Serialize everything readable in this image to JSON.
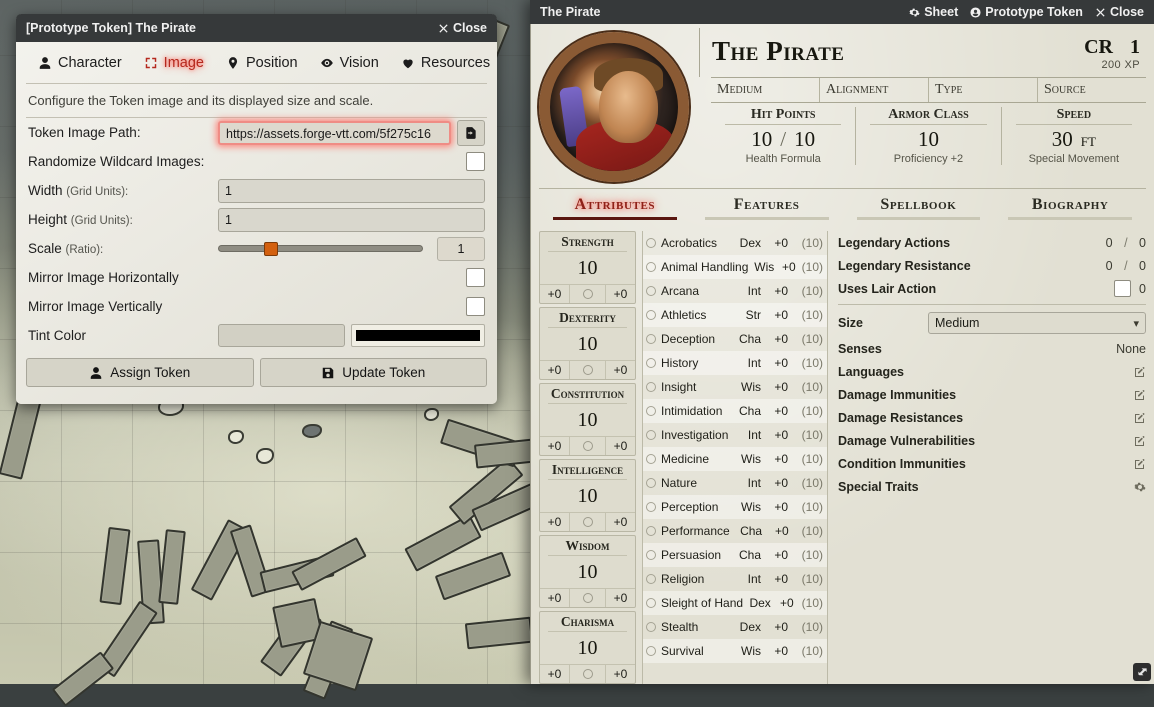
{
  "token_dialog": {
    "title": "[Prototype Token] The Pirate",
    "close_label": "Close",
    "tabs": [
      {
        "label": "Character",
        "icon": "person-icon",
        "active": false
      },
      {
        "label": "Image",
        "icon": "frame-icon",
        "active": true
      },
      {
        "label": "Position",
        "icon": "map-pin-icon",
        "active": false
      },
      {
        "label": "Vision",
        "icon": "eye-icon",
        "active": false
      },
      {
        "label": "Resources",
        "icon": "heart-icon",
        "active": false
      }
    ],
    "hint": "Configure the Token image and its displayed size and scale.",
    "fields": {
      "image_path_label": "Token Image Path:",
      "image_path_value": "https://assets.forge-vtt.com/5f275c16",
      "randomize_label": "Randomize Wildcard Images:",
      "width_label": "Width",
      "width_sub": "(Grid Units):",
      "width_value": "1",
      "height_label": "Height",
      "height_sub": "(Grid Units):",
      "height_value": "1",
      "scale_label": "Scale",
      "scale_sub": "(Ratio):",
      "scale_value": "1",
      "mirror_h_label": "Mirror Image Horizontally",
      "mirror_v_label": "Mirror Image Vertically",
      "tint_label": "Tint Color",
      "tint_value": "",
      "tint_swatch_color": "#000000"
    },
    "buttons": {
      "assign_label": "Assign Token",
      "update_label": "Update Token"
    }
  },
  "sheet": {
    "window_title": "The Pirate",
    "header_buttons": [
      {
        "label": "Sheet",
        "icon": "gear-icon"
      },
      {
        "label": "Prototype Token",
        "icon": "user-circle-icon"
      },
      {
        "label": "Close",
        "icon": "close-icon"
      }
    ],
    "character_name": "The Pirate",
    "cr_label": "CR",
    "cr_value": "1",
    "xp": "200 XP",
    "meta": [
      {
        "label": "Medium"
      },
      {
        "label": "Alignment"
      },
      {
        "label": "Type"
      },
      {
        "label": "Source"
      }
    ],
    "vitals": [
      {
        "title": "Hit Points",
        "value": "10",
        "sep": "/",
        "value2": "10",
        "sub": "Health Formula"
      },
      {
        "title": "Armor Class",
        "value": "10",
        "sub": "Proficiency +2"
      },
      {
        "title": "Speed",
        "value": "30",
        "unit": "FT",
        "sub": "Special Movement"
      }
    ],
    "tabs": [
      {
        "label": "Attributes",
        "active": true
      },
      {
        "label": "Features",
        "active": false
      },
      {
        "label": "Spellbook",
        "active": false
      },
      {
        "label": "Biography",
        "active": false
      }
    ],
    "abilities": [
      {
        "name": "Strength",
        "score": "10",
        "mod": "+0",
        "save": "+0"
      },
      {
        "name": "Dexterity",
        "score": "10",
        "mod": "+0",
        "save": "+0"
      },
      {
        "name": "Constitution",
        "score": "10",
        "mod": "+0",
        "save": "+0"
      },
      {
        "name": "Intelligence",
        "score": "10",
        "mod": "+0",
        "save": "+0"
      },
      {
        "name": "Wisdom",
        "score": "10",
        "mod": "+0",
        "save": "+0"
      },
      {
        "name": "Charisma",
        "score": "10",
        "mod": "+0",
        "save": "+0"
      }
    ],
    "skills": [
      {
        "name": "Acrobatics",
        "ability": "Dex",
        "mod": "+0",
        "passive": "(10)"
      },
      {
        "name": "Animal Handling",
        "ability": "Wis",
        "mod": "+0",
        "passive": "(10)"
      },
      {
        "name": "Arcana",
        "ability": "Int",
        "mod": "+0",
        "passive": "(10)"
      },
      {
        "name": "Athletics",
        "ability": "Str",
        "mod": "+0",
        "passive": "(10)"
      },
      {
        "name": "Deception",
        "ability": "Cha",
        "mod": "+0",
        "passive": "(10)"
      },
      {
        "name": "History",
        "ability": "Int",
        "mod": "+0",
        "passive": "(10)"
      },
      {
        "name": "Insight",
        "ability": "Wis",
        "mod": "+0",
        "passive": "(10)"
      },
      {
        "name": "Intimidation",
        "ability": "Cha",
        "mod": "+0",
        "passive": "(10)"
      },
      {
        "name": "Investigation",
        "ability": "Int",
        "mod": "+0",
        "passive": "(10)"
      },
      {
        "name": "Medicine",
        "ability": "Wis",
        "mod": "+0",
        "passive": "(10)"
      },
      {
        "name": "Nature",
        "ability": "Int",
        "mod": "+0",
        "passive": "(10)"
      },
      {
        "name": "Perception",
        "ability": "Wis",
        "mod": "+0",
        "passive": "(10)"
      },
      {
        "name": "Performance",
        "ability": "Cha",
        "mod": "+0",
        "passive": "(10)"
      },
      {
        "name": "Persuasion",
        "ability": "Cha",
        "mod": "+0",
        "passive": "(10)"
      },
      {
        "name": "Religion",
        "ability": "Int",
        "mod": "+0",
        "passive": "(10)"
      },
      {
        "name": "Sleight of Hand",
        "ability": "Dex",
        "mod": "+0",
        "passive": "(10)"
      },
      {
        "name": "Stealth",
        "ability": "Dex",
        "mod": "+0",
        "passive": "(10)"
      },
      {
        "name": "Survival",
        "ability": "Wis",
        "mod": "+0",
        "passive": "(10)"
      }
    ],
    "legendary": [
      {
        "label": "Legendary Actions",
        "current": "0",
        "sep": "/",
        "max": "0"
      },
      {
        "label": "Legendary Resistance",
        "current": "0",
        "sep": "/",
        "max": "0"
      }
    ],
    "lair": {
      "label": "Uses Lair Action",
      "value": "0"
    },
    "size": {
      "label": "Size",
      "value": "Medium"
    },
    "traits": [
      {
        "label": "Senses",
        "value": "None",
        "icon": null
      },
      {
        "label": "Languages",
        "value": "",
        "icon": "edit-icon"
      },
      {
        "label": "Damage Immunities",
        "value": "",
        "icon": "edit-icon"
      },
      {
        "label": "Damage Resistances",
        "value": "",
        "icon": "edit-icon"
      },
      {
        "label": "Damage Vulnerabilities",
        "value": "",
        "icon": "edit-icon"
      },
      {
        "label": "Condition Immunities",
        "value": "",
        "icon": "edit-icon"
      },
      {
        "label": "Special Traits",
        "value": "",
        "icon": "gear-icon"
      }
    ]
  },
  "colors": {
    "accent_red": "#b5291e",
    "slider_orange": "#d3600f",
    "header_dark": "#36393a",
    "parchment": "#e2e0d3"
  }
}
